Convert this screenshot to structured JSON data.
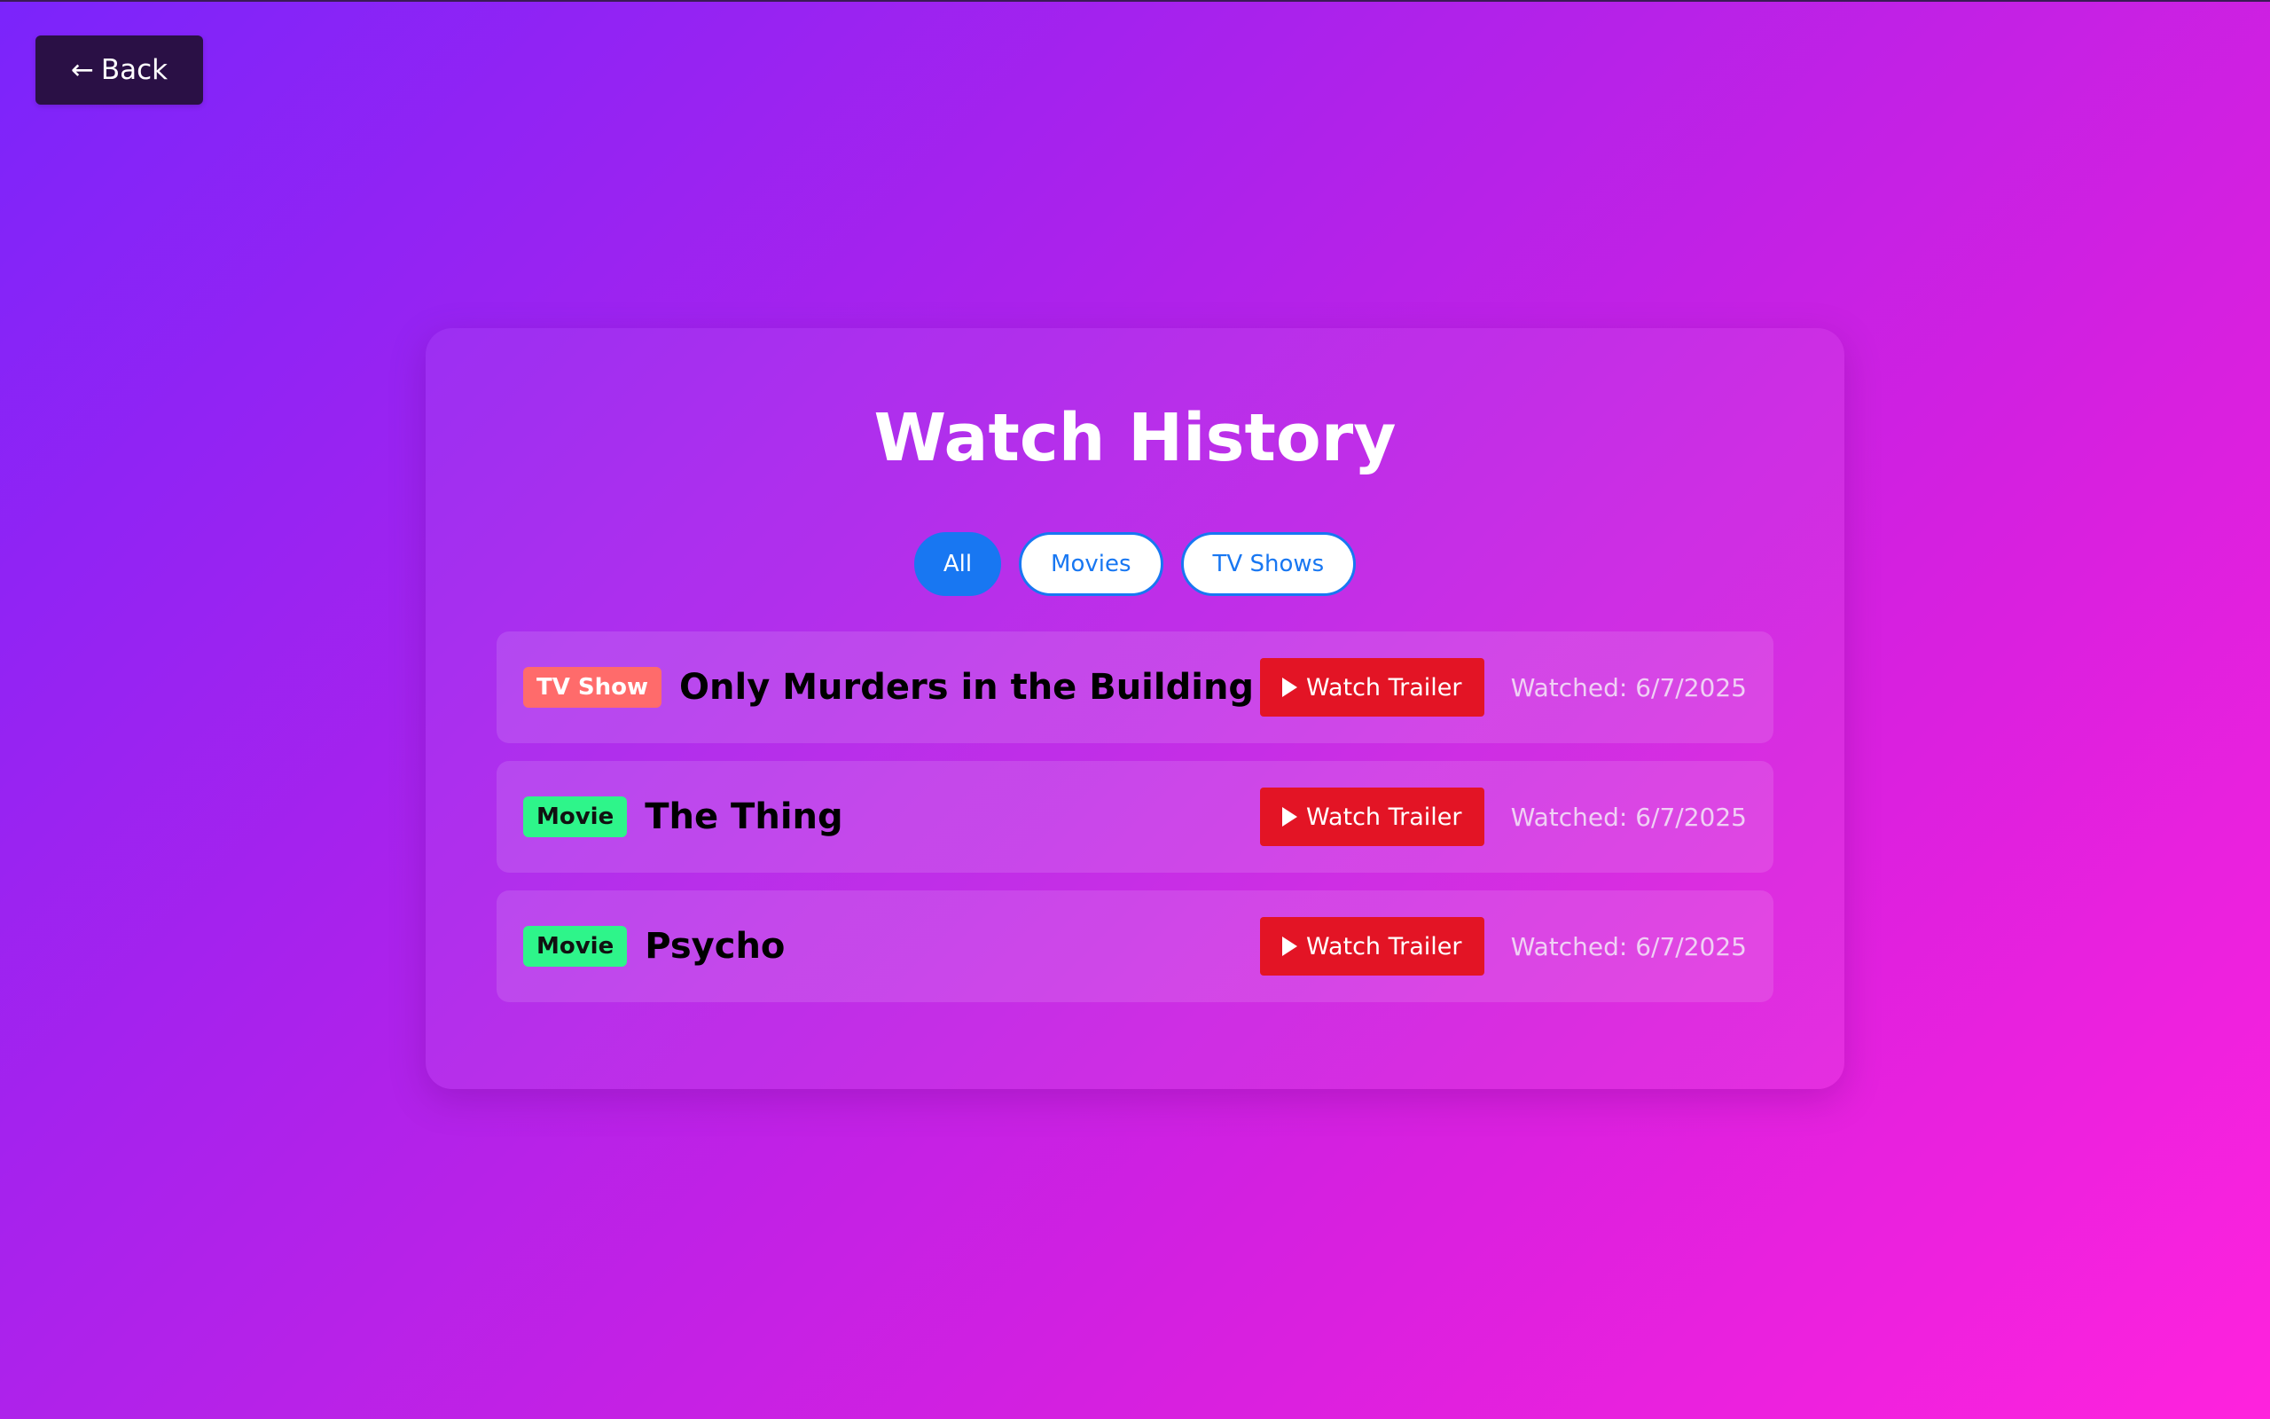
{
  "nav": {
    "back_arrow": "←",
    "back_label": "Back"
  },
  "page": {
    "title": "Watch History"
  },
  "filters": [
    {
      "label": "All",
      "active": true
    },
    {
      "label": "Movies",
      "active": false
    },
    {
      "label": "TV Shows",
      "active": false
    }
  ],
  "items": [
    {
      "type_label": "TV Show",
      "title": "Only Murders in the Building",
      "trailer_label": "Watch Trailer",
      "watched": "Watched: 6/7/2025"
    },
    {
      "type_label": "Movie",
      "title": "The Thing",
      "trailer_label": "Watch Trailer",
      "watched": "Watched: 6/7/2025"
    },
    {
      "type_label": "Movie",
      "title": "Psycho",
      "trailer_label": "Watch Trailer",
      "watched": "Watched: 6/7/2025"
    }
  ],
  "colors": {
    "accent": "#1877f2",
    "trailer": "#e31425",
    "tv_badge": "#ff6b6b",
    "movie_badge": "#2ef58a",
    "back_button": "#2a1045"
  },
  "icons": {
    "back": "arrow-left-icon",
    "play": "play-icon"
  }
}
